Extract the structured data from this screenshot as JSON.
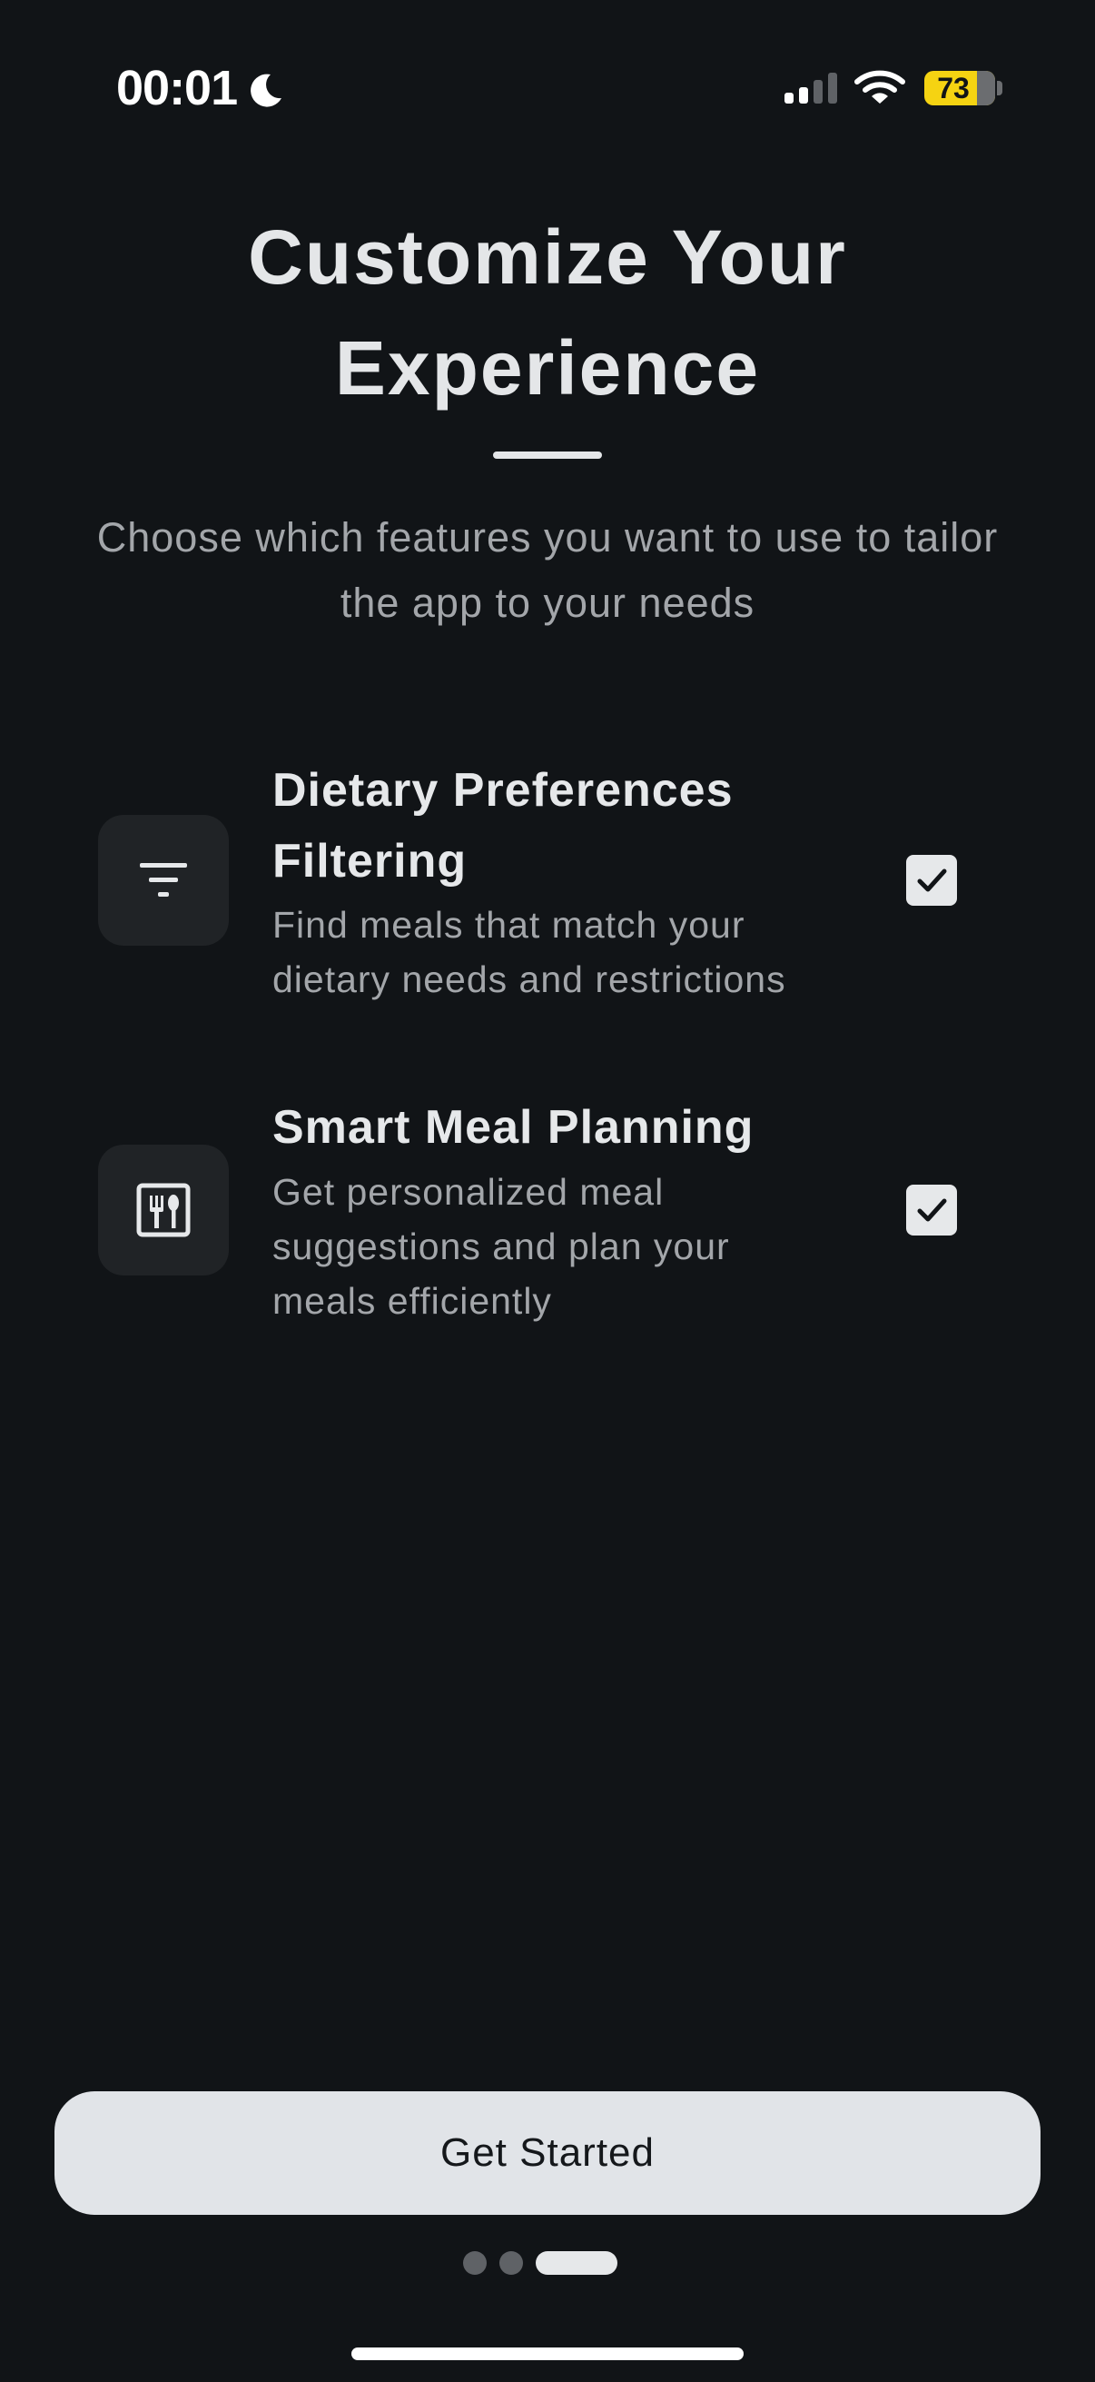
{
  "status_bar": {
    "time": "00:01",
    "battery": "73"
  },
  "header": {
    "title": "Customize Your Experience",
    "subtitle": "Choose which features you want to use to tailor the app to your needs"
  },
  "features": [
    {
      "title": "Dietary Preferences Filtering",
      "description": "Find meals that match your dietary needs and restrictions",
      "icon": "filter-icon",
      "checked": true
    },
    {
      "title": "Smart Meal Planning",
      "description": "Get personalized meal suggestions and plan your meals efficiently",
      "icon": "utensils-icon",
      "checked": true
    }
  ],
  "footer": {
    "button_label": "Get Started",
    "page_count": 3,
    "current_page": 3
  },
  "colors": {
    "background": "#111417",
    "battery": "#f5d312",
    "button": "#e1e4e8"
  }
}
